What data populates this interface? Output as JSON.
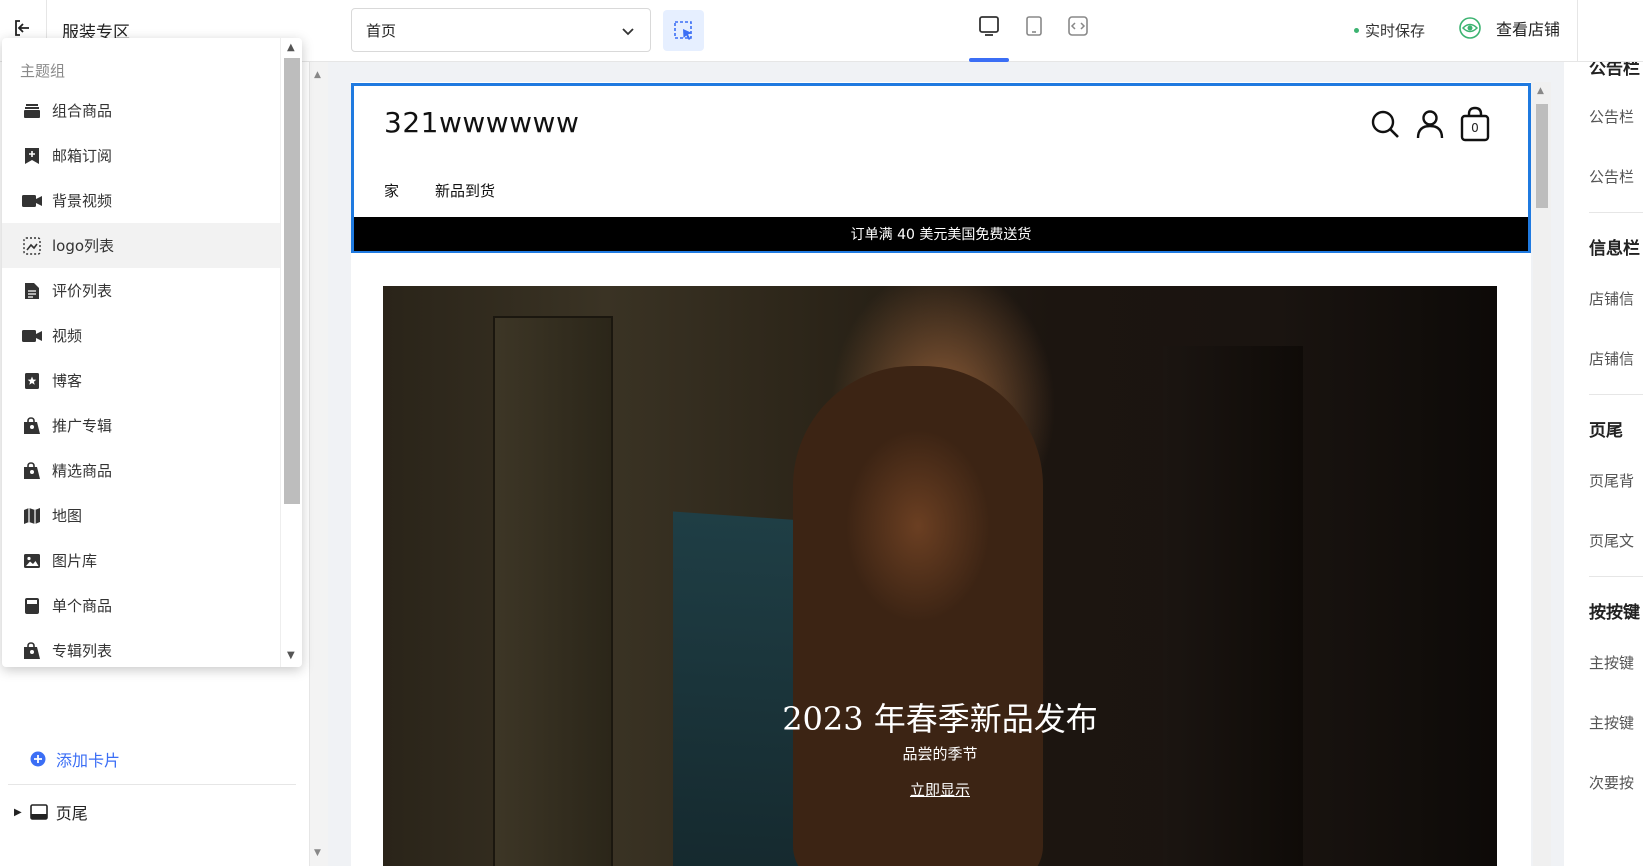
{
  "topbar": {
    "store_title": "服装专区",
    "page_select_value": "首页",
    "save_status": "实时保存",
    "view_store": "查看店铺"
  },
  "theme_dropdown": {
    "header": "主题组",
    "items": [
      {
        "label": "组合商品",
        "icon": "stack-icon"
      },
      {
        "label": "邮箱订阅",
        "icon": "bookmark-plus-icon"
      },
      {
        "label": "背景视频",
        "icon": "video-camera-icon"
      },
      {
        "label": "logo列表",
        "icon": "logo-list-icon"
      },
      {
        "label": "评价列表",
        "icon": "document-icon"
      },
      {
        "label": "视频",
        "icon": "video-camera-icon"
      },
      {
        "label": "博客",
        "icon": "blog-star-icon"
      },
      {
        "label": "推广专辑",
        "icon": "tag-bag-icon"
      },
      {
        "label": "精选商品",
        "icon": "tag-bag-icon"
      },
      {
        "label": "地图",
        "icon": "map-icon"
      },
      {
        "label": "图片库",
        "icon": "image-icon"
      },
      {
        "label": "单个商品",
        "icon": "product-box-icon"
      },
      {
        "label": "专辑列表",
        "icon": "tag-bag-icon"
      }
    ]
  },
  "left_panel": {
    "add_card": "添加卡片",
    "footer_label": "页尾"
  },
  "preview": {
    "shop_name": "321wwwwww",
    "cart_count": "0",
    "nav": [
      "家",
      "新品到货"
    ],
    "announcement": "订单满 40 美元美国免费送货",
    "hero": {
      "title": "2023 年春季新品发布",
      "subtitle": "品尝的季节",
      "cta": "立即显示"
    }
  },
  "right_panel": {
    "items": [
      {
        "kind": "head",
        "text": "公告栏"
      },
      {
        "kind": "item",
        "text": "公告栏"
      },
      {
        "kind": "item",
        "text": "公告栏"
      },
      {
        "kind": "head",
        "text": "信息栏"
      },
      {
        "kind": "item",
        "text": "店铺信"
      },
      {
        "kind": "item",
        "text": "店铺信"
      },
      {
        "kind": "head",
        "text": "页尾"
      },
      {
        "kind": "item",
        "text": "页尾背"
      },
      {
        "kind": "item",
        "text": "页尾文"
      },
      {
        "kind": "head",
        "text": "按按键"
      },
      {
        "kind": "item",
        "text": "主按键"
      },
      {
        "kind": "item",
        "text": "主按键"
      },
      {
        "kind": "item",
        "text": "次要按"
      }
    ]
  },
  "colors": {
    "accent": "#3b6ef5",
    "selection_border": "#1f7ae0",
    "announcement_bg": "#000000",
    "save_dot": "#3cb371"
  }
}
